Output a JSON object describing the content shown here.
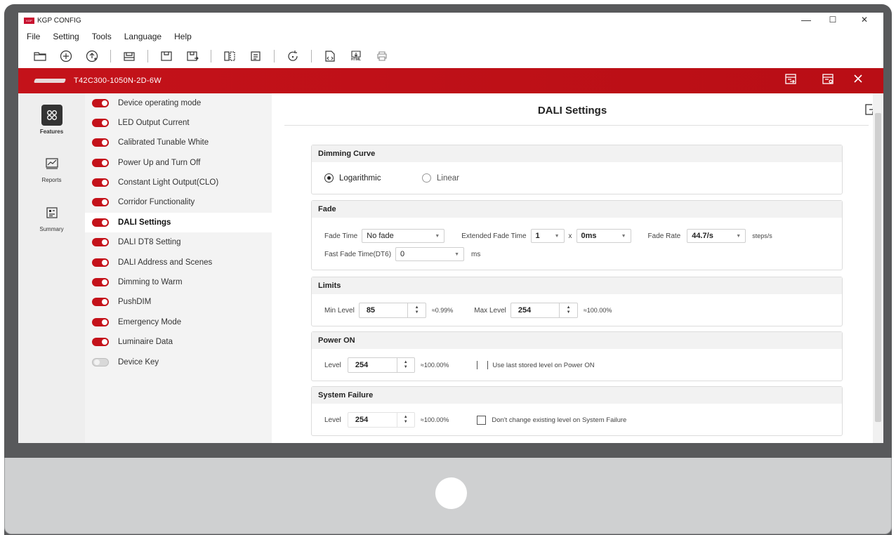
{
  "app": {
    "title": "KGP CONFIG",
    "logo_text": "KGP"
  },
  "window_controls": {
    "minimize": "—",
    "maximize": "☐",
    "close": "✕"
  },
  "menu": [
    "File",
    "Setting",
    "Tools",
    "Language",
    "Help"
  ],
  "toolbar": {
    "icons": [
      "folder-open-icon",
      "add-circle-icon",
      "add-upload-icon",
      "device-read-icon",
      "device-save-icon",
      "device-write-icon",
      "compare-icon",
      "document-icon",
      "refresh-icon",
      "report-icon",
      "html-export-icon",
      "print-icon"
    ],
    "html_label": "HTML"
  },
  "device": {
    "name": "T42C300-1050N-2D-6W"
  },
  "left_nav": [
    {
      "label": "Features",
      "icon": "features-grid-icon",
      "active": true
    },
    {
      "label": "Reports",
      "icon": "reports-chart-icon",
      "active": false
    },
    {
      "label": "Summary",
      "icon": "summary-icon",
      "active": false
    }
  ],
  "features": [
    {
      "label": "Device operating mode",
      "enabled": true,
      "active": false
    },
    {
      "label": "LED Output Current",
      "enabled": true,
      "active": false
    },
    {
      "label": "Calibrated Tunable White",
      "enabled": true,
      "active": false
    },
    {
      "label": "Power Up and Turn Off",
      "enabled": true,
      "active": false
    },
    {
      "label": "Constant Light Output(CLO)",
      "enabled": true,
      "active": false
    },
    {
      "label": "Corridor Functionality",
      "enabled": true,
      "active": false
    },
    {
      "label": "DALI Settings",
      "enabled": true,
      "active": true
    },
    {
      "label": "DALI DT8 Setting",
      "enabled": true,
      "active": false
    },
    {
      "label": "DALI Address and Scenes",
      "enabled": true,
      "active": false
    },
    {
      "label": "Dimming to Warm",
      "enabled": true,
      "active": false
    },
    {
      "label": "PushDIM",
      "enabled": true,
      "active": false
    },
    {
      "label": "Emergency Mode",
      "enabled": true,
      "active": false
    },
    {
      "label": "Luminaire Data",
      "enabled": true,
      "active": false
    },
    {
      "label": "Device Key",
      "enabled": false,
      "active": false
    }
  ],
  "page": {
    "title": "DALI Settings",
    "dimming_curve": {
      "header": "Dimming Curve",
      "options": [
        "Logarithmic",
        "Linear"
      ],
      "selected": "Logarithmic"
    },
    "fade": {
      "header": "Fade",
      "fade_time_label": "Fade Time",
      "fade_time_value": "No fade",
      "extended_fade_label": "Extended Fade Time",
      "extended_fade_multiplier": "1",
      "x_label": "x",
      "extended_fade_base": "0ms",
      "fade_rate_label": "Fade Rate",
      "fade_rate_value": "44.7/s",
      "fade_rate_unit": "steps/s",
      "fast_fade_label": "Fast Fade Time(DT6)",
      "fast_fade_value": "0",
      "fast_fade_unit": "ms"
    },
    "limits": {
      "header": "Limits",
      "min_label": "Min Level",
      "min_value": "85",
      "min_pct": "≈0.99%",
      "max_label": "Max Level",
      "max_value": "254",
      "max_pct": "≈100.00%"
    },
    "power_on": {
      "header": "Power ON",
      "level_label": "Level",
      "level_value": "254",
      "level_pct": "≈100.00%",
      "checkbox_label": "Use last stored level on Power ON",
      "checked": false
    },
    "system_failure": {
      "header": "System Failure",
      "level_label": "Level",
      "level_value": "254",
      "level_pct": "≈100.00%",
      "checkbox_label": "Don't change existing level on System Failure",
      "checked": false
    }
  },
  "colors": {
    "brand_red": "#c4121a",
    "toggle_on": "#c4121a",
    "toggle_off": "#d8d8d8"
  }
}
